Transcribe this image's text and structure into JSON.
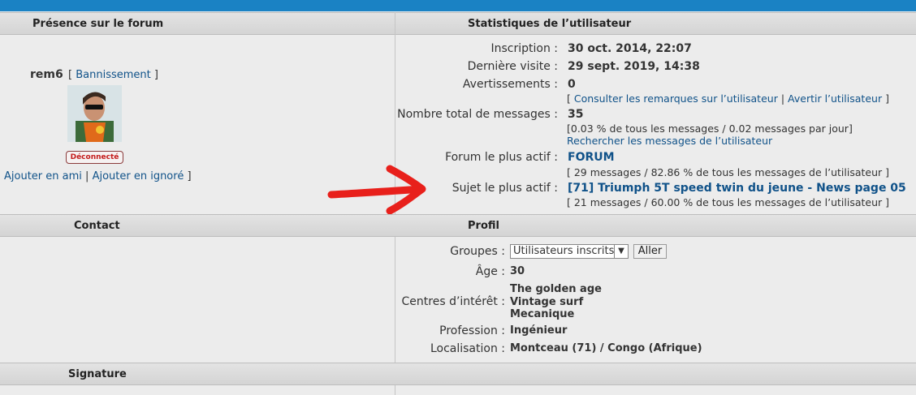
{
  "left": {
    "presence_header": "Présence sur le forum",
    "username": "rem6",
    "ban_open": "[",
    "ban_link": "Bannissement",
    "ban_close": "]",
    "status_badge": "Déconnecté",
    "add_friend": "Ajouter en ami",
    "sep": "|",
    "add_ignore": "Ajouter en ignoré",
    "bracket_close": "]",
    "contact_header": "Contact",
    "signature_header": "Signature"
  },
  "stats": {
    "header": "Statistiques de l’utilisateur",
    "rows": [
      {
        "label": "Inscription :",
        "value": "30 oct. 2014, 22:07"
      },
      {
        "label": "Dernière visite :",
        "value": "29 sept. 2019, 14:38"
      },
      {
        "label": "Avertissements :",
        "value": "0"
      },
      {
        "label": "Nombre total de messages :",
        "value": "35"
      },
      {
        "label": "Forum le plus actif :",
        "value": "FORUM"
      },
      {
        "label": "Sujet le plus actif :",
        "value": "[71] Triumph 5T speed twin du jeune - News page 05"
      }
    ],
    "warn_open": "[",
    "warn_link1": "Consulter les remarques sur l’utilisateur",
    "warn_sep": "|",
    "warn_link2": "Avertir l’utilisateur",
    "warn_close": "]",
    "msg_pct": "[0.03 % de tous les messages / 0.02 messages par jour]",
    "msg_search": "Rechercher les messages de l’utilisateur",
    "forum_sub": "[ 29 messages / 82.86 % de tous les messages de l’utilisateur ]",
    "topic_sub": "[ 21 messages / 60.00 % de tous les messages de l’utilisateur ]"
  },
  "profile": {
    "header": "Profil",
    "groups_label": "Groupes :",
    "groups_selected": "Utilisateurs inscrits",
    "go_button": "Aller",
    "age_label": "Âge :",
    "age_value": "30",
    "interests_label": "Centres d’intérêt :",
    "interests": [
      "The golden age",
      "Vintage surf",
      "Mecanique"
    ],
    "job_label": "Profession :",
    "job_value": "Ingénieur",
    "location_label": "Localisation :",
    "location_value": "Montceau (71) / Congo (Afrique)"
  },
  "colors": {
    "accent": "#1a82c4",
    "link": "#105289",
    "annotation_arrow": "#e8201b"
  }
}
